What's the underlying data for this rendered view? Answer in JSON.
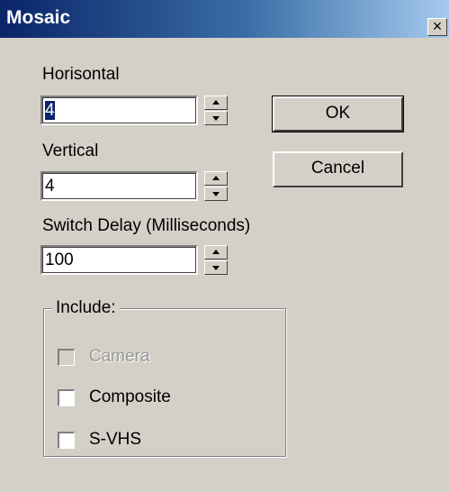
{
  "window": {
    "title": "Mosaic",
    "close_symbol": "×"
  },
  "horizontal": {
    "label": "Horisontal",
    "value": "4"
  },
  "vertical": {
    "label": "Vertical",
    "value": "4"
  },
  "switch_delay": {
    "label": "Switch Delay (Milliseconds)",
    "value": "100"
  },
  "buttons": {
    "ok": "OK",
    "cancel": "Cancel"
  },
  "include": {
    "legend": "Include:",
    "camera": {
      "label": "Camera",
      "checked": false,
      "enabled": false
    },
    "composite": {
      "label": "Composite",
      "checked": false,
      "enabled": true
    },
    "svhs": {
      "label": "S-VHS",
      "checked": false,
      "enabled": true
    }
  },
  "colors": {
    "title_gradient_start": "#0a246a",
    "title_gradient_end": "#a6caf0",
    "dialog_bg": "#d4d0c8",
    "selection": "#0a246a"
  }
}
